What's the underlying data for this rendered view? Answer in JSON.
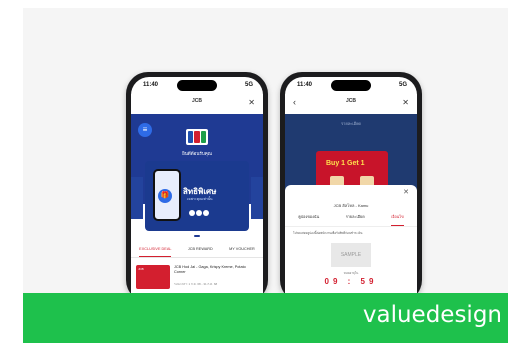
{
  "colors": {
    "brand_green": "#1ec14c",
    "jcb_blue": "#1f3a93",
    "accent_red": "#d31f2f"
  },
  "left_phone": {
    "status": {
      "time": "11:40",
      "signal": "5G"
    },
    "app_title": "JCB",
    "app_subtitle": "",
    "close_icon": "close-icon",
    "menu_icon": "menu-icon",
    "welcome": "ยินดีต้อนรับคุณ",
    "promo": {
      "headline": "สิทธิพิเศษ",
      "subline": "เฉพาะคุณเท่านั้น"
    },
    "tabs": [
      "EXCLUSIVE DEAL",
      "JCB REWARD",
      "MY VOUCHER"
    ],
    "deal": {
      "thumb_text": "JCB",
      "title": "JCB Hod Jai - Gaga, Krispy Kreme, Potato Corner",
      "meta": "ระยะเวลา: 1 ก.ค. 68 - 31 ก.ค. 68"
    }
  },
  "right_phone": {
    "status": {
      "time": "11:40",
      "signal": "5G"
    },
    "app_title": "JCB",
    "back_icon": "chevron-left-icon",
    "close_icon": "close-icon",
    "dim_header": "รายละเอียด",
    "promo_text": "Buy 1 Get 1",
    "sheet": {
      "name": "JCB ฮัลโหล - Kamu",
      "tabs": [
        "คูปองของฉัน",
        "รายละเอียด",
        "เงื่อนไข"
      ],
      "description": "โปรดแสดงคูปองนี้ต่อพนักงานเพื่อรับสิทธิ์ก่อนชำระเงิน",
      "sample_label": "SAMPLE",
      "countdown_label": "หมดอายุใน",
      "countdown": "09 : 59"
    }
  },
  "brand": {
    "name": "valuedesign"
  }
}
